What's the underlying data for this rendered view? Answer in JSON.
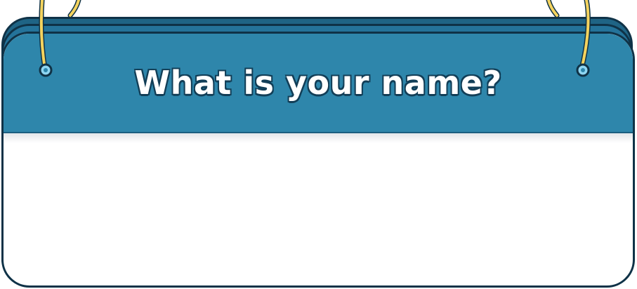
{
  "prompt": {
    "question": "What is your name?"
  },
  "answer": {
    "value": ""
  },
  "colors": {
    "header": "#2e86ab",
    "outline": "#0f3247",
    "panel": "#ffffff",
    "string": "#f4d35e"
  },
  "icons": {
    "left_ring": "ring-eyelet-icon",
    "right_ring": "ring-eyelet-icon"
  }
}
